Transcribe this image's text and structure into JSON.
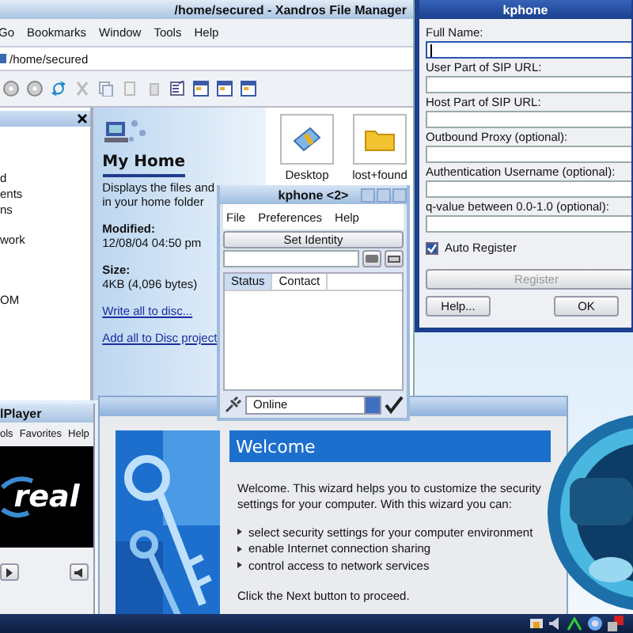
{
  "file_manager": {
    "title": "/home/secured - Xandros File Manager",
    "menu": [
      "Go",
      "Bookmarks",
      "Window",
      "Tools",
      "Help"
    ],
    "address": "/home/secured",
    "sidebar_items": [
      "d",
      "ents",
      "ns",
      "work",
      "OM"
    ],
    "home_panel": {
      "heading": "My Home",
      "description": [
        "Displays the files and",
        "in your home folder"
      ],
      "modified_label": "Modified:",
      "modified": "12/08/04 04:50 pm",
      "size_label": "Size:",
      "size": "4KB (4,096 bytes)",
      "links": [
        "Write all to disc...",
        "Add all to Disc project"
      ]
    },
    "folders": [
      {
        "label": "Desktop",
        "kind": "desktop"
      },
      {
        "label": "lost+found",
        "kind": "folder"
      }
    ]
  },
  "kphone": {
    "title": "kphone",
    "fields": [
      {
        "label": "Full Name:",
        "focused": true
      },
      {
        "label": "User Part of SIP URL:",
        "focused": false
      },
      {
        "label": "Host Part of SIP URL:",
        "focused": false
      },
      {
        "label": "Outbound Proxy (optional):",
        "focused": false
      },
      {
        "label": "Authentication Username (optional):",
        "focused": false
      },
      {
        "label": "q-value between 0.0-1.0 (optional):",
        "focused": false
      }
    ],
    "auto_register": {
      "label": "Auto Register",
      "checked": true
    },
    "register_button": {
      "label": "Register",
      "disabled": true
    },
    "buttons": [
      "Help...",
      "OK"
    ]
  },
  "kphone2": {
    "title": "kphone <2>",
    "menu": [
      "File",
      "Preferences",
      "Help"
    ],
    "set_identity": "Set Identity",
    "columns": [
      {
        "label": "Status",
        "selected": true
      },
      {
        "label": "Contact",
        "selected": false
      }
    ],
    "status": "Online"
  },
  "realplayer": {
    "title": "lPlayer",
    "menu": [
      "ols",
      "Favorites",
      "Help"
    ],
    "logo": "real"
  },
  "wizard": {
    "heading": "Welcome",
    "intro": "Welcome. This wizard helps you to customize the security settings for your computer. With this wizard you can:",
    "bullets": [
      "select security settings for your computer environment",
      "enable Internet connection sharing",
      "control access to network services"
    ],
    "footer": "Click the Next button to proceed."
  }
}
